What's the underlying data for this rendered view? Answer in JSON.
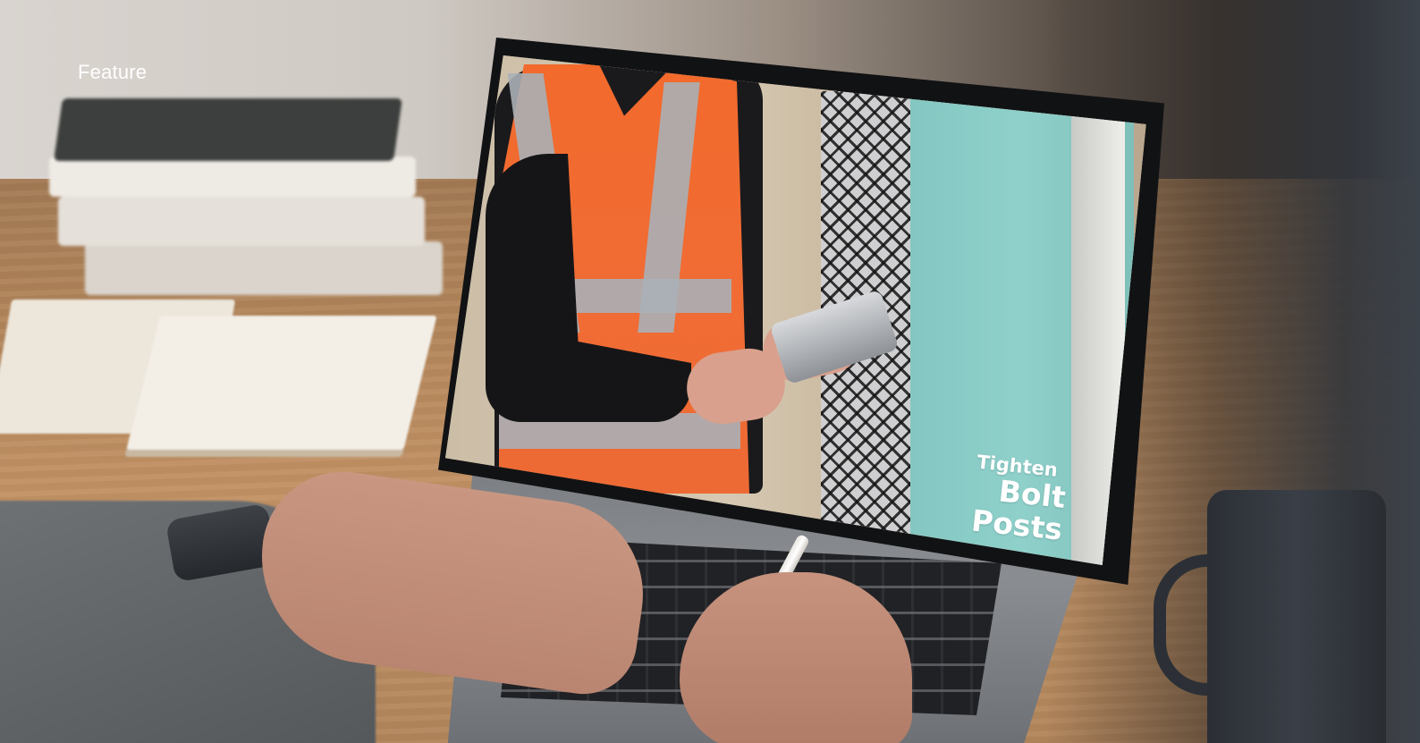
{
  "header": {
    "section_label": "Feature"
  },
  "video_frame": {
    "caption_line1": "Tighten",
    "caption_line2": "Bolt Posts"
  },
  "colors": {
    "vest": "#f06c34",
    "door": "#8fd0ca",
    "desk": "#b98a5e"
  }
}
